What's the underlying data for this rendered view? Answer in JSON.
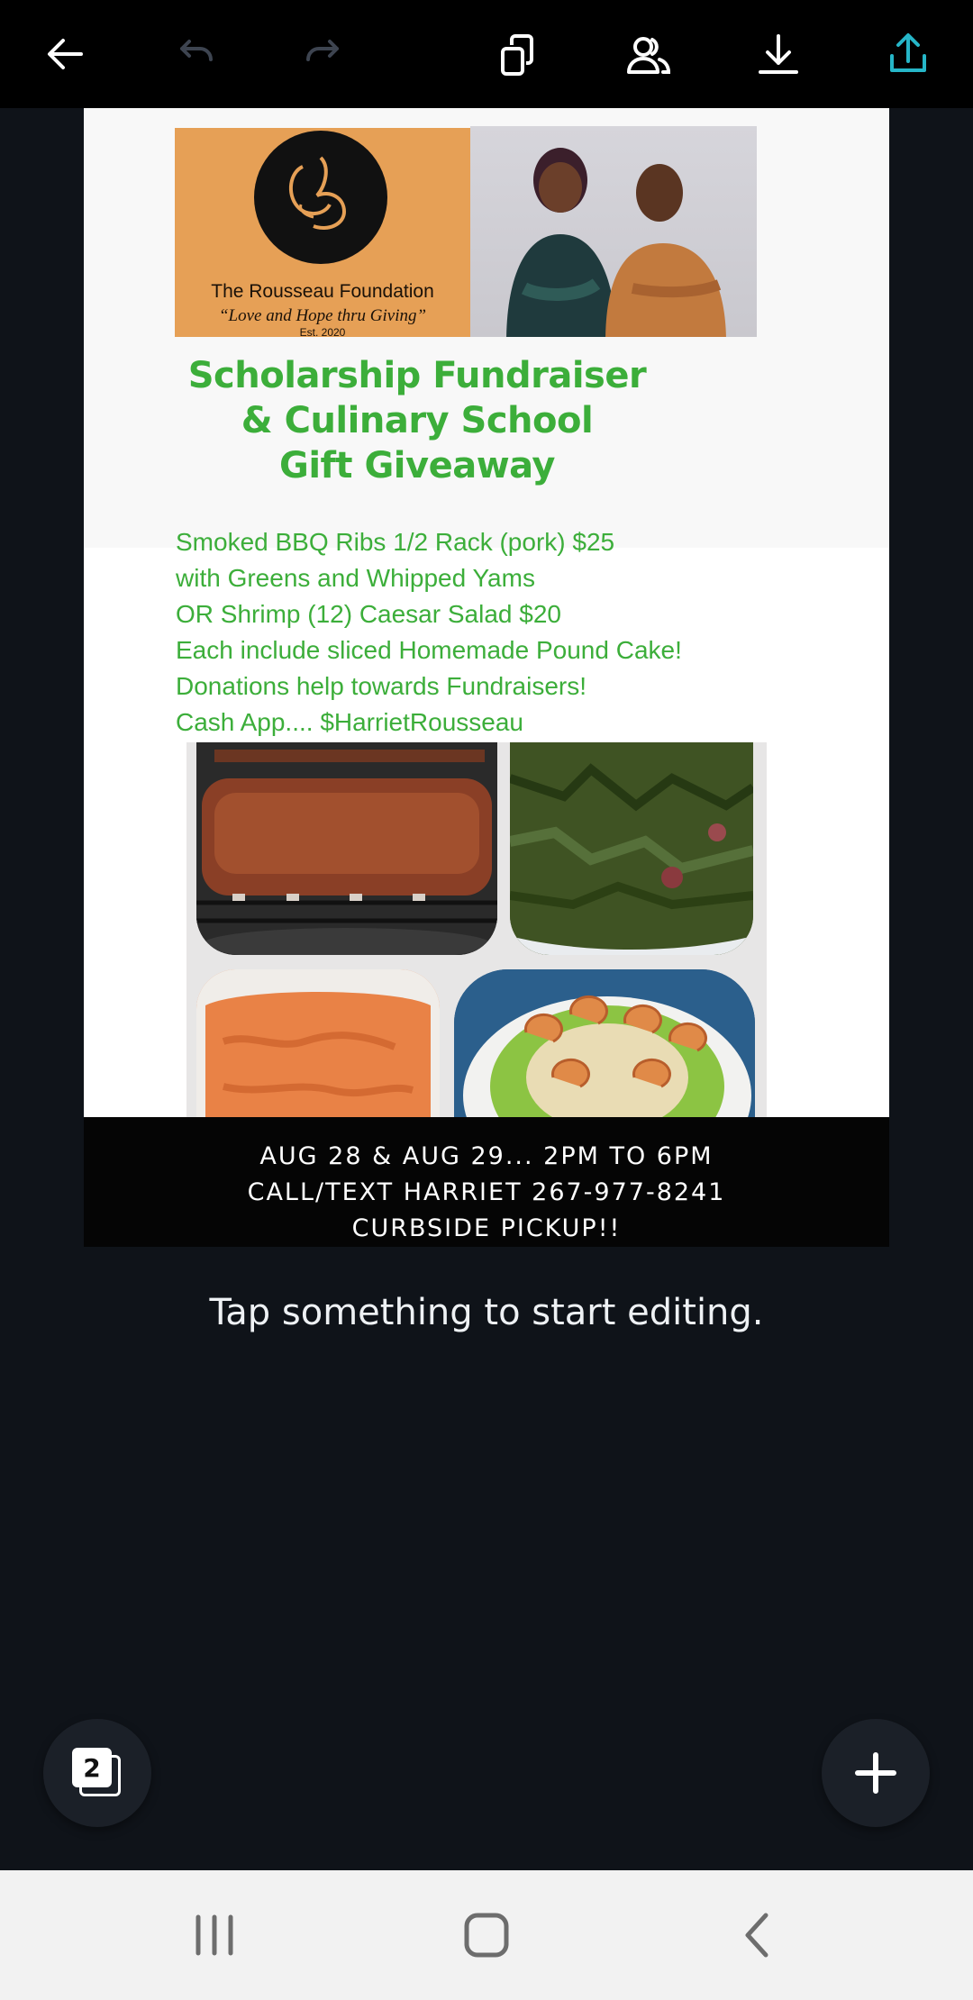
{
  "toolbar": {
    "icons": [
      "back-arrow-icon",
      "undo-icon",
      "redo-icon",
      "copy-page-icon",
      "collaborate-icon",
      "download-icon",
      "share-upload-icon"
    ],
    "accent_color": "#26b6c8"
  },
  "design": {
    "logo": {
      "org_name": "The Rousseau Foundation",
      "motto": "“Love and Hope thru Giving”",
      "established": "Est. 2020"
    },
    "headline": [
      "Scholarship Fundraiser",
      "& Culinary School",
      "Gift Giveaway"
    ],
    "headline_color": "#3cae3a",
    "menu_lines": [
      "Smoked BBQ Ribs  1/2 Rack (pork) $25",
      "with Greens and Whipped Yams",
      "OR Shrimp (12) Caesar Salad $20",
      "Each include sliced Homemade Pound Cake!",
      "Donations help towards Fundraisers!",
      "Cash App....  $HarrietRousseau"
    ],
    "food_photos": [
      "bbq-ribs-photo",
      "collard-greens-photo",
      "whipped-yams-photo",
      "shrimp-caesar-salad-photo"
    ],
    "info_lines": [
      "AUG 28 & AUG 29... 2PM TO 6PM",
      "CALL/TEXT HARRIET  267-977-8241",
      "CURBSIDE PICKUP!!"
    ]
  },
  "hint_text": "Tap something to start editing.",
  "pages_button": {
    "count": "2"
  },
  "add_button": {
    "icon": "plus-icon"
  },
  "nav": {
    "icons": [
      "recent-apps-icon",
      "home-icon",
      "back-icon"
    ]
  }
}
